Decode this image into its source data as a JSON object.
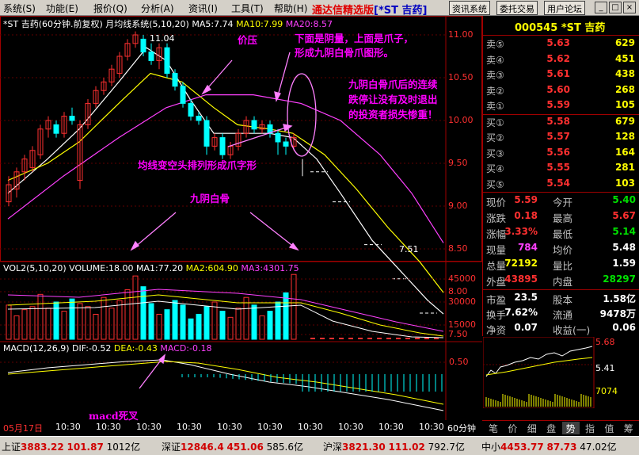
{
  "menu": {
    "items": [
      "系统(S)",
      "功能(E)",
      "报价(Q)",
      "分析(A)",
      "资讯(I)",
      "工具(T)",
      "帮助(H)"
    ],
    "app_title": "通达信精选版",
    "app_tag": "[*ST 吉药]",
    "buttons": [
      "资讯系统",
      "委托交易",
      "用户论坛"
    ],
    "win_buttons": [
      "_",
      "□",
      "×"
    ]
  },
  "main_info": {
    "title": "*ST 吉药(60分钟.前复权) 月均线系统(5,10,20)",
    "ma5": "MA5:7.74",
    "ma10": "MA10:7.99",
    "ma20": "MA20:8.57"
  },
  "price_axis": [
    "11.00",
    "10.50",
    "10.00",
    "9.50",
    "9.00",
    "8.50",
    "8.00",
    "7.50"
  ],
  "price_marks": {
    "high": "11.04",
    "low": "7.51"
  },
  "vol_info": {
    "label": "VOL2(5,10,20) VOLUME:18.00",
    "ma1": "MA1:77.20",
    "ma2": "MA2:604.90",
    "ma3": "MA3:4301.75"
  },
  "vol_axis": [
    "45000",
    "30000",
    "15000"
  ],
  "macd_info": {
    "label": "MACD(12,26,9)",
    "dif": "DIF:-0.52",
    "dea": "DEA:-0.43",
    "macd": "MACD:-0.18"
  },
  "macd_axis": [
    "0.50"
  ],
  "time_axis": [
    "05月17日",
    "10:30",
    "10:30",
    "10:30",
    "10:30",
    "10:30",
    "10:30",
    "10:30",
    "10:30",
    "10:30",
    "10:30"
  ],
  "period_label": "60分钟",
  "annotations": {
    "pressure": "价压",
    "claw_line1": "下面是阴量，上面是爪子，",
    "claw_line2": "形成九阴白骨爪图形。",
    "loss_line1": "九阴白骨爪后的连续",
    "loss_line2": "跌停让没有及时退出",
    "loss_line3": "的投资者损失惨重！",
    "ma_bear": "均线变空头排列形成爪字形",
    "nine_yin": "九阴白骨",
    "macd_death": "macd死叉"
  },
  "quote": {
    "code": "000545",
    "name": "*ST 吉药",
    "asks": [
      {
        "label": "卖⑤",
        "price": "5.63",
        "vol": "629"
      },
      {
        "label": "卖④",
        "price": "5.62",
        "vol": "451"
      },
      {
        "label": "卖③",
        "price": "5.61",
        "vol": "438"
      },
      {
        "label": "卖②",
        "price": "5.60",
        "vol": "268"
      },
      {
        "label": "卖①",
        "price": "5.59",
        "vol": "105"
      }
    ],
    "bids": [
      {
        "label": "买①",
        "price": "5.58",
        "vol": "679"
      },
      {
        "label": "买②",
        "price": "5.57",
        "vol": "128"
      },
      {
        "label": "买③",
        "price": "5.56",
        "vol": "164"
      },
      {
        "label": "买④",
        "price": "5.55",
        "vol": "281"
      },
      {
        "label": "买⑤",
        "price": "5.54",
        "vol": "103"
      }
    ],
    "stats": [
      {
        "k1": "现价",
        "v1": "5.59",
        "k2": "今开",
        "v2": "5.40"
      },
      {
        "k1": "涨跌",
        "v1": "0.18",
        "k2": "最高",
        "v2": "5.67"
      },
      {
        "k1": "涨幅",
        "v1": "3.33%",
        "k2": "最低",
        "v2": "5.14"
      },
      {
        "k1": "现量",
        "v1": "784",
        "k2": "均价",
        "v2": "5.48"
      },
      {
        "k1": "总量",
        "v1": "72192",
        "k2": "量比",
        "v2": "1.59"
      },
      {
        "k1": "外盘",
        "v1": "43895",
        "k2": "内盘",
        "v2": "28297"
      }
    ],
    "fund": [
      {
        "k1": "市盈",
        "v1": "23.5",
        "k2": "股本",
        "v2": "1.58亿"
      },
      {
        "k1": "换手",
        "v1": "7.62%",
        "k2": "流通",
        "v2": "9478万"
      },
      {
        "k1": "净资",
        "v1": "0.07",
        "k2": "收益(一)",
        "v2": "0.06"
      }
    ],
    "mini": {
      "high": "5.68",
      "mid": "5.41",
      "vol": "7074"
    }
  },
  "tabs": [
    "笔",
    "价",
    "细",
    "盘",
    "势",
    "指",
    "值",
    "筹"
  ],
  "active_tab": "势",
  "status": {
    "sh_label": "上证",
    "sh_val": "3883.22",
    "sh_chg": "101.87",
    "sh_amt": "1012亿",
    "sz_label": "深证",
    "sz_val": "12846.4",
    "sz_chg": "451.06",
    "sz_amt": "585.6亿",
    "hs_label": "沪深",
    "hs_val": "3821.30",
    "hs_chg": "111.02",
    "hs_amt": "792.7亿",
    "zx_label": "中小",
    "zx_val": "4453.77",
    "zx_chg": "87.73",
    "zx_amt": "47.02亿"
  },
  "colors": {
    "up": "#ff3030",
    "down": "#00ffff",
    "ma5": "#ffffff",
    "ma10": "#ffff00",
    "ma20": "#ff40ff",
    "annot": "#ff00ff"
  }
}
